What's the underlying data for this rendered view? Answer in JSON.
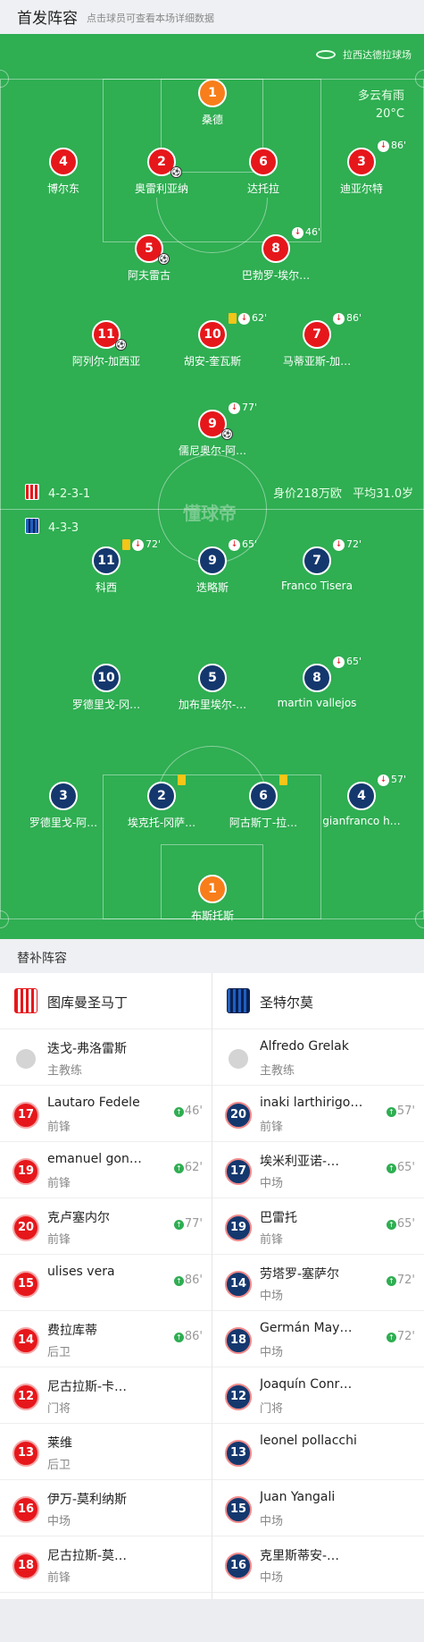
{
  "header": {
    "title": "首发阵容",
    "subtitle": "点击球员可查看本场详细数据"
  },
  "pitch": {
    "stadium": "拉西达德拉球场",
    "weather": "多云有雨",
    "temperature": "20°C",
    "watermark": "懂球帝",
    "home_formation": "4-2-3-1",
    "away_formation": "4-3-3",
    "value": "身价218万欧",
    "avg_age": "平均31.0岁"
  },
  "home_players": [
    {
      "num": "1",
      "name": "桑德",
      "event": "",
      "color": "orange"
    },
    {
      "num": "4",
      "name": "博尔东",
      "event": "",
      "color": "red"
    },
    {
      "num": "2",
      "name": "奥雷利亚纳",
      "event": "",
      "color": "red",
      "ball": "⚽"
    },
    {
      "num": "6",
      "name": "达托拉",
      "event": "",
      "color": "red"
    },
    {
      "num": "3",
      "name": "迪亚尔特",
      "event": "86'",
      "color": "red"
    },
    {
      "num": "5",
      "name": "阿夫雷古",
      "event": "",
      "color": "red",
      "ball": "⚽"
    },
    {
      "num": "8",
      "name": "巴勃罗-埃尔…",
      "event": "46'",
      "color": "red"
    },
    {
      "num": "11",
      "name": "阿列尔-加西亚",
      "event": "",
      "color": "red",
      "ball": "⚽"
    },
    {
      "num": "10",
      "name": "胡安-奎瓦斯",
      "event": "62'",
      "color": "red"
    },
    {
      "num": "7",
      "name": "马蒂亚斯-加…",
      "event": "86'",
      "color": "red"
    },
    {
      "num": "9",
      "name": "儒尼奥尔-阿…",
      "event": "77'",
      "color": "red",
      "ball": "⚽"
    }
  ],
  "away_players": [
    {
      "num": "11",
      "name": "科西",
      "event": "72'",
      "color": "blue"
    },
    {
      "num": "9",
      "name": "迭略斯",
      "event": "65'",
      "color": "blue"
    },
    {
      "num": "7",
      "name": "Franco Tisera",
      "event": "72'",
      "color": "blue"
    },
    {
      "num": "10",
      "name": "罗德里戈-冈…",
      "event": "",
      "color": "blue"
    },
    {
      "num": "5",
      "name": "加布里埃尔-…",
      "event": "",
      "color": "blue"
    },
    {
      "num": "8",
      "name": "martin vallejos",
      "event": "65'",
      "color": "blue"
    },
    {
      "num": "3",
      "name": "罗德里戈-阿…",
      "event": "",
      "color": "blue"
    },
    {
      "num": "2",
      "name": "埃克托-冈萨…",
      "event": "",
      "color": "blue"
    },
    {
      "num": "6",
      "name": "阿古斯丁-拉…",
      "event": "",
      "color": "blue"
    },
    {
      "num": "4",
      "name": "gianfranco h…",
      "event": "57'",
      "color": "blue"
    },
    {
      "num": "1",
      "name": "布斯托斯",
      "event": "",
      "color": "orange"
    }
  ],
  "subs": {
    "title": "替补阵容",
    "home": {
      "team": "图库曼圣马丁",
      "coach": {
        "name": "迭戈-弗洛雷斯",
        "role": "主教练"
      },
      "players": [
        {
          "num": "17",
          "name": "Lautaro Fedele",
          "pos": "前锋",
          "time": "46'"
        },
        {
          "num": "19",
          "name": "emanuel gon…",
          "pos": "前锋",
          "time": "62'"
        },
        {
          "num": "20",
          "name": "克卢塞内尔",
          "pos": "前锋",
          "time": "77'"
        },
        {
          "num": "15",
          "name": "ulises vera",
          "pos": "",
          "time": "86'"
        },
        {
          "num": "14",
          "name": "费拉库蒂",
          "pos": "后卫",
          "time": "86'"
        },
        {
          "num": "12",
          "name": "尼古拉斯-卡…",
          "pos": "门将",
          "time": ""
        },
        {
          "num": "13",
          "name": "莱维",
          "pos": "后卫",
          "time": ""
        },
        {
          "num": "16",
          "name": "伊万-莫利纳斯",
          "pos": "中场",
          "time": ""
        },
        {
          "num": "18",
          "name": "尼古拉斯-莫…",
          "pos": "前锋",
          "time": ""
        }
      ]
    },
    "away": {
      "team": "圣特尔莫",
      "coach": {
        "name": "Alfredo Grelak",
        "role": "主教练"
      },
      "players": [
        {
          "num": "20",
          "name": "inaki larthirigo…",
          "pos": "前锋",
          "time": "57'"
        },
        {
          "num": "17",
          "name": "埃米利亚诺-…",
          "pos": "中场",
          "time": "65'"
        },
        {
          "num": "19",
          "name": "巴雷托",
          "pos": "前锋",
          "time": "65'"
        },
        {
          "num": "14",
          "name": "劳塔罗-塞萨尔",
          "pos": "中场",
          "time": "72'"
        },
        {
          "num": "18",
          "name": "Germán May…",
          "pos": "中场",
          "time": "72'"
        },
        {
          "num": "12",
          "name": "Joaquín Conr…",
          "pos": "门将",
          "time": ""
        },
        {
          "num": "13",
          "name": "leonel pollacchi",
          "pos": "",
          "time": ""
        },
        {
          "num": "15",
          "name": "Juan Yangali",
          "pos": "中场",
          "time": ""
        },
        {
          "num": "16",
          "name": "克里斯蒂安-…",
          "pos": "中场",
          "time": ""
        }
      ]
    }
  }
}
